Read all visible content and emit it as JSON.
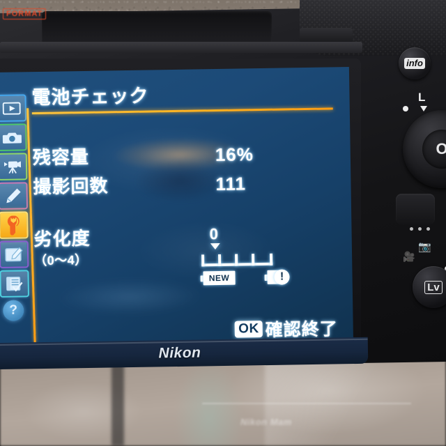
{
  "device": {
    "brand": "Nikon",
    "format_label": "FORMAT",
    "accent_orange": "#ffb21f",
    "lcd_blue": "#1c4a77"
  },
  "screen": {
    "title": "電池チェック",
    "rows": [
      {
        "label": "残容量",
        "value": "16%"
      },
      {
        "label": "撮影回数",
        "value": "111"
      }
    ],
    "degradation": {
      "label": "劣化度",
      "range_label": "（0〜4）",
      "value": "0",
      "scale_ticks": 5,
      "new_label": "NEW",
      "warn_glyph": "!"
    },
    "footer": {
      "ok_chip": "OK",
      "ok_text": "確認終了"
    },
    "sidebar": [
      {
        "name": "playback-menu",
        "icon": "play-icon",
        "border": "b-blue",
        "active": false
      },
      {
        "name": "shooting-menu",
        "icon": "camera-icon",
        "border": "b-green",
        "active": false
      },
      {
        "name": "movie-menu",
        "icon": "movie-icon",
        "border": "b-ltgreen",
        "active": false
      },
      {
        "name": "custom-menu",
        "icon": "pencil-icon",
        "border": "b-pink",
        "active": false
      },
      {
        "name": "setup-menu",
        "icon": "wrench-icon",
        "border": "b-blue",
        "active": true
      },
      {
        "name": "retouch-menu",
        "icon": "brush-icon",
        "border": "b-purple",
        "active": false
      },
      {
        "name": "my-menu",
        "icon": "checklist-icon",
        "border": "b-cyan",
        "active": false
      },
      {
        "name": "help",
        "icon": "question-icon",
        "border": "",
        "active": false
      }
    ]
  },
  "controls": {
    "info_button": "info",
    "lock_marker": "L",
    "dial_center": "O",
    "live_view_button": "Lv"
  },
  "background": {
    "bag_text": "Nikon Mam"
  }
}
